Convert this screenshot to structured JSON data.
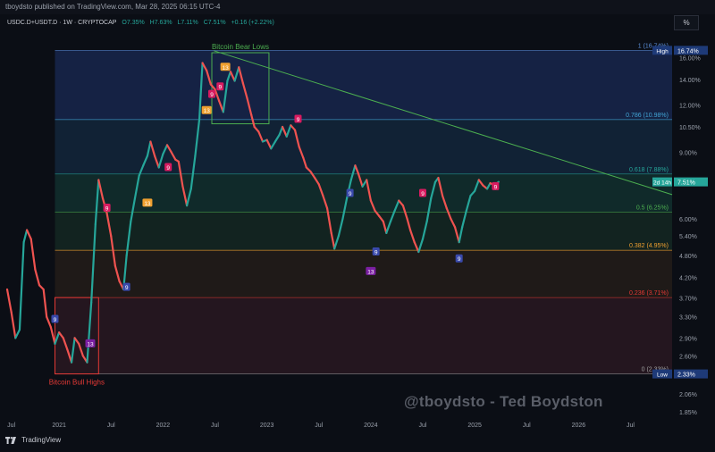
{
  "header": {
    "publisher_line": "tboydsto published on TradingView.com, Mar 28, 2025 06:15 UTC-4",
    "symbol": "USDC.D+USDT.D · 1W · CRYPTOCAP",
    "ohlc_o": "O7.35%",
    "ohlc_h": "H7.63%",
    "ohlc_l": "L7.11%",
    "ohlc_c": "C7.51%",
    "change": "+0.16 (+2.22%)",
    "scale_button": "%"
  },
  "watermark": "@tboydsto - Ted Boydston",
  "footer": {
    "brand": "TradingView"
  },
  "colors": {
    "background": "#0b0e15",
    "up": "#26a69a",
    "down": "#ef5350",
    "trendline": "#4caf50",
    "box": "#4caf50",
    "box_high": "#e53935"
  },
  "chart_data": {
    "type": "line",
    "title": "USDC.D+USDT.D · 1W · CRYPTOCAP",
    "xlabel": "",
    "ylabel": "",
    "scale": "log",
    "ylim": [
      1.8,
      18.5
    ],
    "xlim": [
      2020.5,
      2026.9
    ],
    "x_ticks": [
      {
        "x": 2020.54,
        "label": "Jul"
      },
      {
        "x": 2021.0,
        "label": "2021"
      },
      {
        "x": 2021.5,
        "label": "Jul"
      },
      {
        "x": 2022.0,
        "label": "2022"
      },
      {
        "x": 2022.5,
        "label": "Jul"
      },
      {
        "x": 2023.0,
        "label": "2023"
      },
      {
        "x": 2023.5,
        "label": "Jul"
      },
      {
        "x": 2024.0,
        "label": "2024"
      },
      {
        "x": 2024.5,
        "label": "Jul"
      },
      {
        "x": 2025.0,
        "label": "2025"
      },
      {
        "x": 2025.5,
        "label": "Jul"
      },
      {
        "x": 2026.0,
        "label": "2026"
      },
      {
        "x": 2026.5,
        "label": "Jul"
      }
    ],
    "y_ticks": [
      {
        "y": 16.0,
        "label": "16.00%"
      },
      {
        "y": 14.0,
        "label": "14.00%"
      },
      {
        "y": 12.0,
        "label": "12.00%"
      },
      {
        "y": 10.5,
        "label": "10.50%"
      },
      {
        "y": 9.0,
        "label": "9.00%"
      },
      {
        "y": 6.0,
        "label": "6.00%"
      },
      {
        "y": 5.4,
        "label": "5.40%"
      },
      {
        "y": 4.8,
        "label": "4.80%"
      },
      {
        "y": 4.2,
        "label": "4.20%"
      },
      {
        "y": 3.7,
        "label": "3.70%"
      },
      {
        "y": 3.3,
        "label": "3.30%"
      },
      {
        "y": 2.9,
        "label": "2.90%"
      },
      {
        "y": 2.6,
        "label": "2.60%"
      },
      {
        "y": 2.06,
        "label": "2.06%"
      },
      {
        "y": 1.85,
        "label": "1.85%"
      }
    ],
    "fib_levels": [
      {
        "ratio": "1",
        "value": 16.74,
        "label": "1 (16.74%)",
        "color": "#5b8dd6",
        "fill": "#152244"
      },
      {
        "ratio": "0.786",
        "value": 10.98,
        "label": "0.786 (10.98%)",
        "color": "#42a5d6",
        "fill": "#112235"
      },
      {
        "ratio": "0.618",
        "value": 7.88,
        "label": "0.618 (7.88%)",
        "color": "#26a69a",
        "fill": "#102a2a"
      },
      {
        "ratio": "0.5",
        "value": 6.25,
        "label": "0.5 (6.25%)",
        "color": "#4caf50",
        "fill": "#122320"
      },
      {
        "ratio": "0.382",
        "value": 4.95,
        "label": "0.382 (4.95%)",
        "color": "#f0a030",
        "fill": "#1f1a18"
      },
      {
        "ratio": "0.236",
        "value": 3.71,
        "label": "0.236 (3.71%)",
        "color": "#e53935",
        "fill": "#24161f"
      },
      {
        "ratio": "0",
        "value": 2.33,
        "label": "0 (2.33%)",
        "color": "#9e9e9e",
        "fill": ""
      }
    ],
    "price_tags": [
      {
        "value": 16.74,
        "label": "16.74%",
        "tag": "High",
        "color": "#1e3a78"
      },
      {
        "value": 7.51,
        "label": "7.51%",
        "tag": "2d 14h",
        "color": "#26a69a"
      },
      {
        "value": 2.33,
        "label": "2.33%",
        "tag": "Low",
        "color": "#1e3a78"
      }
    ],
    "boxes": [
      {
        "label": "Bitcoin Bear Lows",
        "x": [
          2022.47,
          2023.02
        ],
        "y": [
          10.7,
          16.5
        ],
        "color": "#4caf50",
        "label_pos": "top"
      },
      {
        "label": "Bitcoin Bull Highs",
        "x": [
          2020.96,
          2021.38
        ],
        "y": [
          2.33,
          3.71
        ],
        "color": "#e53935",
        "label_pos": "bottom"
      }
    ],
    "trendline": {
      "x": [
        2022.49,
        2026.9
      ],
      "y": [
        16.7,
        6.95
      ],
      "color": "#4caf50"
    },
    "series": [
      {
        "name": "USDC.D+USDT.D",
        "x": [
          2020.5,
          2020.54,
          2020.58,
          2020.62,
          2020.66,
          2020.69,
          2020.73,
          2020.77,
          2020.81,
          2020.85,
          2020.88,
          2020.92,
          2020.96,
          2021.0,
          2021.04,
          2021.08,
          2021.12,
          2021.15,
          2021.19,
          2021.23,
          2021.27,
          2021.31,
          2021.35,
          2021.38,
          2021.42,
          2021.46,
          2021.5,
          2021.54,
          2021.58,
          2021.62,
          2021.65,
          2021.69,
          2021.73,
          2021.77,
          2021.81,
          2021.85,
          2021.88,
          2021.92,
          2021.96,
          2022.0,
          2022.04,
          2022.08,
          2022.12,
          2022.15,
          2022.19,
          2022.23,
          2022.27,
          2022.31,
          2022.35,
          2022.38,
          2022.42,
          2022.46,
          2022.5,
          2022.54,
          2022.58,
          2022.62,
          2022.65,
          2022.69,
          2022.73,
          2022.77,
          2022.81,
          2022.85,
          2022.88,
          2022.92,
          2022.96,
          2023.0,
          2023.04,
          2023.08,
          2023.12,
          2023.15,
          2023.19,
          2023.23,
          2023.27,
          2023.31,
          2023.35,
          2023.38,
          2023.42,
          2023.46,
          2023.5,
          2023.54,
          2023.58,
          2023.62,
          2023.65,
          2023.69,
          2023.73,
          2023.77,
          2023.81,
          2023.85,
          2023.88,
          2023.92,
          2023.96,
          2024.0,
          2024.04,
          2024.08,
          2024.12,
          2024.15,
          2024.19,
          2024.23,
          2024.27,
          2024.31,
          2024.35,
          2024.38,
          2024.42,
          2024.46,
          2024.5,
          2024.54,
          2024.58,
          2024.62,
          2024.65,
          2024.69,
          2024.73,
          2024.77,
          2024.81,
          2024.85,
          2024.88,
          2024.92,
          2024.96,
          2025.0,
          2025.04,
          2025.08,
          2025.12,
          2025.15,
          2025.19,
          2025.23
        ],
        "y": [
          3.9,
          3.4,
          2.9,
          3.05,
          5.2,
          5.6,
          5.3,
          4.4,
          4.0,
          3.9,
          3.3,
          3.1,
          2.8,
          3.0,
          2.9,
          2.7,
          2.5,
          2.9,
          2.8,
          2.6,
          2.5,
          3.6,
          5.8,
          7.6,
          6.8,
          6.2,
          5.4,
          4.5,
          4.1,
          3.9,
          4.8,
          5.9,
          6.8,
          7.8,
          8.3,
          8.8,
          9.6,
          8.8,
          8.2,
          8.9,
          9.4,
          9.0,
          8.6,
          8.5,
          7.3,
          6.5,
          7.2,
          8.8,
          11.0,
          15.5,
          14.8,
          13.6,
          13.2,
          12.3,
          11.5,
          13.9,
          14.7,
          13.9,
          15.1,
          13.7,
          12.5,
          11.3,
          10.5,
          10.2,
          9.6,
          9.7,
          9.2,
          9.6,
          10.0,
          10.5,
          9.9,
          10.6,
          10.3,
          9.3,
          8.7,
          8.2,
          8.0,
          7.7,
          7.4,
          6.9,
          6.4,
          5.5,
          5.0,
          5.4,
          6.0,
          6.8,
          7.6,
          8.3,
          7.9,
          7.3,
          7.6,
          6.7,
          6.3,
          6.1,
          5.9,
          5.5,
          5.9,
          6.3,
          6.7,
          6.5,
          6.0,
          5.6,
          5.2,
          4.9,
          5.3,
          5.9,
          6.8,
          7.5,
          7.7,
          6.9,
          6.4,
          6.0,
          5.7,
          5.2,
          5.7,
          6.3,
          6.9,
          7.1,
          7.6,
          7.35,
          7.2,
          7.45,
          7.35,
          7.51
        ]
      }
    ],
    "markers": [
      {
        "x": 2022.42,
        "y": 11.6,
        "label": "13",
        "color": "#f0a030"
      },
      {
        "x": 2022.6,
        "y": 15.1,
        "label": "13",
        "color": "#f0a030"
      },
      {
        "x": 2021.85,
        "y": 6.6,
        "label": "13",
        "color": "#f0a030"
      },
      {
        "x": 2022.55,
        "y": 13.4,
        "label": "9",
        "color": "#d81b60"
      },
      {
        "x": 2022.05,
        "y": 8.2,
        "label": "9",
        "color": "#d81b60"
      },
      {
        "x": 2021.46,
        "y": 6.4,
        "label": "9",
        "color": "#d81b60"
      },
      {
        "x": 2022.47,
        "y": 12.8,
        "label": "9",
        "color": "#d81b60"
      },
      {
        "x": 2023.3,
        "y": 11.0,
        "label": "9",
        "color": "#d81b60"
      },
      {
        "x": 2024.5,
        "y": 7.0,
        "label": "9",
        "color": "#d81b60"
      },
      {
        "x": 2025.2,
        "y": 7.3,
        "label": "9",
        "color": "#d81b60"
      },
      {
        "x": 2021.3,
        "y": 2.8,
        "label": "13",
        "color": "#7b1fa2"
      },
      {
        "x": 2024.0,
        "y": 4.35,
        "label": "13",
        "color": "#7b1fa2"
      },
      {
        "x": 2020.96,
        "y": 3.25,
        "label": "9",
        "color": "#3949ab"
      },
      {
        "x": 2021.65,
        "y": 3.95,
        "label": "9",
        "color": "#3949ab"
      },
      {
        "x": 2023.8,
        "y": 7.0,
        "label": "9",
        "color": "#3949ab"
      },
      {
        "x": 2024.05,
        "y": 4.9,
        "label": "9",
        "color": "#3949ab"
      },
      {
        "x": 2024.85,
        "y": 4.7,
        "label": "9",
        "color": "#3949ab"
      }
    ]
  }
}
